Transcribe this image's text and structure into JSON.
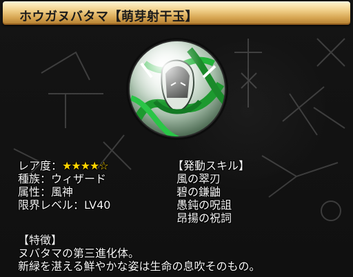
{
  "title": "ホウガヌバタマ【萌芽射干玉】",
  "stats": {
    "rarity_label": "レア度：",
    "rarity_stars": "★★★★☆",
    "tribe": "種族：ウィザード",
    "attribute": "属性：風神",
    "limit_level": "限界レベル：LV40"
  },
  "skills": {
    "header": "【発動スキル】",
    "items": [
      "風の翠刃",
      "碧の鎌鼬",
      "愚鈍の呪詛",
      "昂揚の祝詞"
    ]
  },
  "description": {
    "header": "【特徴】",
    "lines": [
      "ヌバタマの第三進化体。",
      "新緑を湛える鮮やかな姿は生命の息吹そのもの。"
    ]
  },
  "icons": {
    "orb": "green-wizard-character-orb-icon"
  },
  "colors": {
    "title_gold": "#d7a652",
    "star": "#ffd400",
    "orb_green": "#1d9a2f",
    "background": "#151515"
  }
}
